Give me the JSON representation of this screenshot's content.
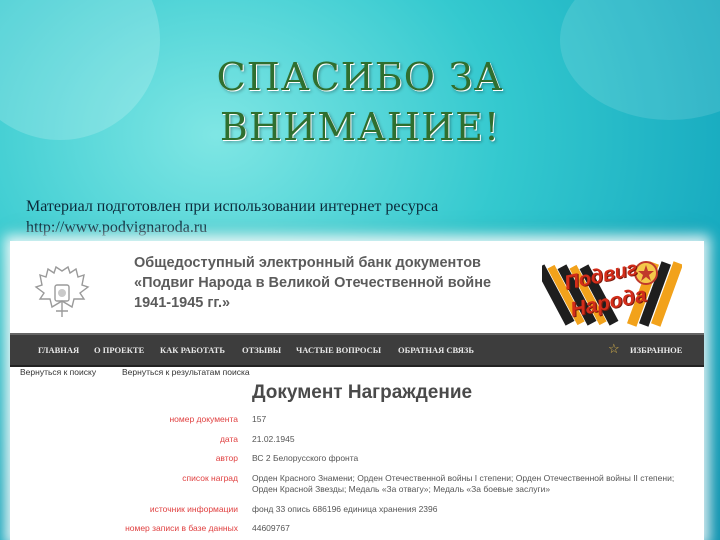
{
  "slide": {
    "title_line1": "СПАСИБО ЗА",
    "title_line2": "ВНИМАНИЕ!",
    "caption_line1": "Материал подготовлен при использовании интернет ресурса",
    "caption_line2": "http://www.podvignaroda.ru"
  },
  "site": {
    "title_line1": "Общедоступный электронный банк документов",
    "title_line2": "«Подвиг Народа в Великой Отечественной войне",
    "title_line3": "1941-1945 гг.»",
    "logo_word1": "Подвиг",
    "logo_word2": "Народа",
    "nav": [
      {
        "label": "ГЛАВНАЯ"
      },
      {
        "label": "О ПРОЕКТЕ"
      },
      {
        "label": "КАК РАБОТАТЬ"
      },
      {
        "label": "ОТЗЫВЫ"
      },
      {
        "label": "ЧАСТЫЕ ВОПРОСЫ"
      },
      {
        "label": "ОБРАТНАЯ СВЯЗЬ"
      },
      {
        "label": "ИЗБРАННОЕ"
      }
    ],
    "crumbs": {
      "back_search": "Вернуться к поиску",
      "back_results": "Вернуться к результатам поиска"
    },
    "doc_title": "Документ Награждение",
    "fields": [
      {
        "label": "номер документа",
        "value": "157"
      },
      {
        "label": "дата",
        "value": "21.02.1945"
      },
      {
        "label": "автор",
        "value": "ВС 2 Белорусского фронта"
      },
      {
        "label": "список наград",
        "value": "Орден Красного Знамени; Орден Отечественной войны I степени; Орден Отечественной войны II степени; Орден Красной Звезды; Медаль «За отвагу»; Медаль «За боевые заслуги»"
      },
      {
        "label": "источник информации",
        "value": "фонд 33 опись 686196 единица хранения 2396"
      },
      {
        "label": "номер записи в базе данных",
        "value": "44609767"
      }
    ]
  }
}
